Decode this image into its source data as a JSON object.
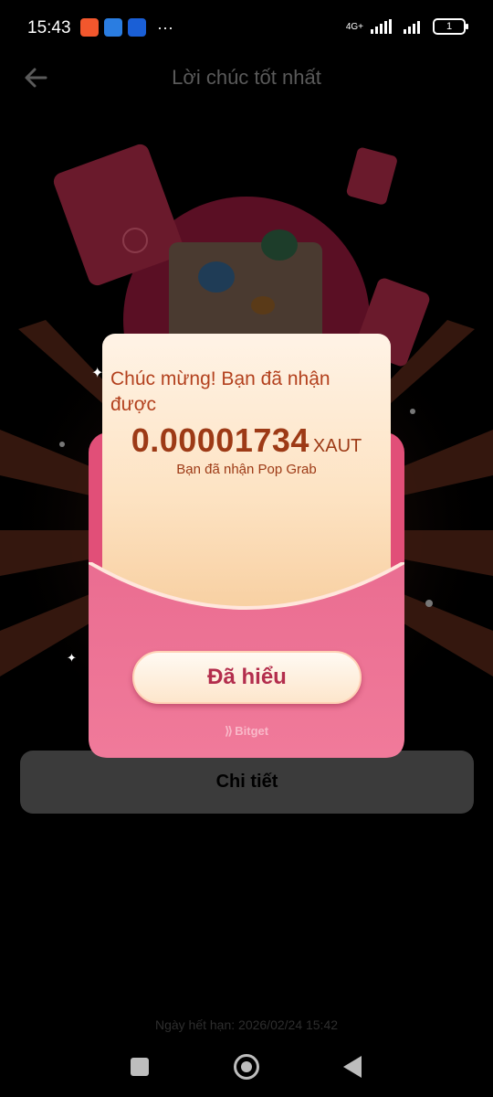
{
  "status_bar": {
    "time": "15:43",
    "more": "···",
    "network": "4G+",
    "battery": "1"
  },
  "header": {
    "title": "Lời chúc tốt nhất"
  },
  "modal": {
    "congrats": "Chúc mừng! Bạn đã nhận được",
    "amount": "0.00001734",
    "unit": "XAUT",
    "received": "Bạn đã nhận Pop Grab",
    "ok_button": "Đã hiểu",
    "brand": "Bitget",
    "brand_icon": "bitget-logo-icon"
  },
  "details_button": "Chi tiết",
  "expiry": "Ngày hết hạn: 2026/02/24 15:42",
  "colors": {
    "envelope": "#e14f78",
    "letter": "#fde3c3",
    "amount_text": "#9d3a16",
    "background": "#000000"
  }
}
